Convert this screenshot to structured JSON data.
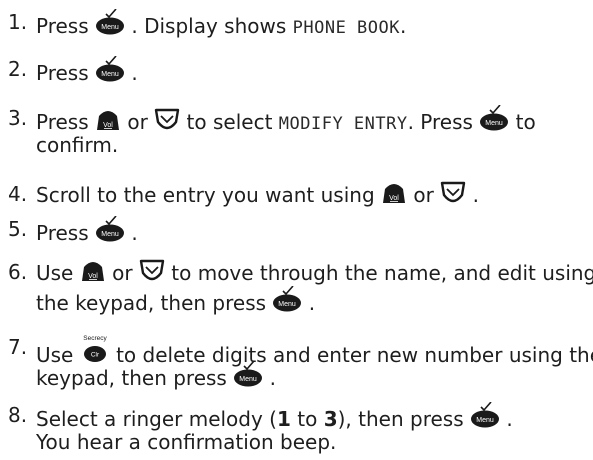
{
  "icons": {
    "menu_key_label": "Menu",
    "vol_key_label": "Vol",
    "clear_key_label": "Clr",
    "clear_key_caption": "Secrecy"
  },
  "steps": [
    {
      "num": "1.",
      "a": "Press ",
      "b": ". Display shows ",
      "lcd": "PHONE BOOK",
      "c": "."
    },
    {
      "num": "2.",
      "a": "Press ",
      "b": "."
    },
    {
      "num": "3.",
      "a": "Press ",
      "b": " or ",
      "c": " to select ",
      "lcd": "MODIFY ENTRY",
      "d": ". Press ",
      "e": " to",
      "line2": "confirm."
    },
    {
      "num": "4.",
      "a": "Scroll to the entry you want using ",
      "b": " or ",
      "c": "."
    },
    {
      "num": "5.",
      "a": "Press ",
      "b": "."
    },
    {
      "num": "6.",
      "a": "Use ",
      "b": " or ",
      "c": " to move through the name, and edit using",
      "line2a": "the keypad, then press ",
      "line2b": "."
    },
    {
      "num": "7.",
      "a": "Use ",
      "b": " to delete digits and enter new number using the",
      "line2a": "keypad, then press ",
      "line2b": "."
    },
    {
      "num": "8.",
      "a": "Select a ringer melody (",
      "bold1": "1",
      "b": " to ",
      "bold2": "3",
      "c": "), then press ",
      "d": ".",
      "line2": "You hear a confirmation beep."
    }
  ]
}
